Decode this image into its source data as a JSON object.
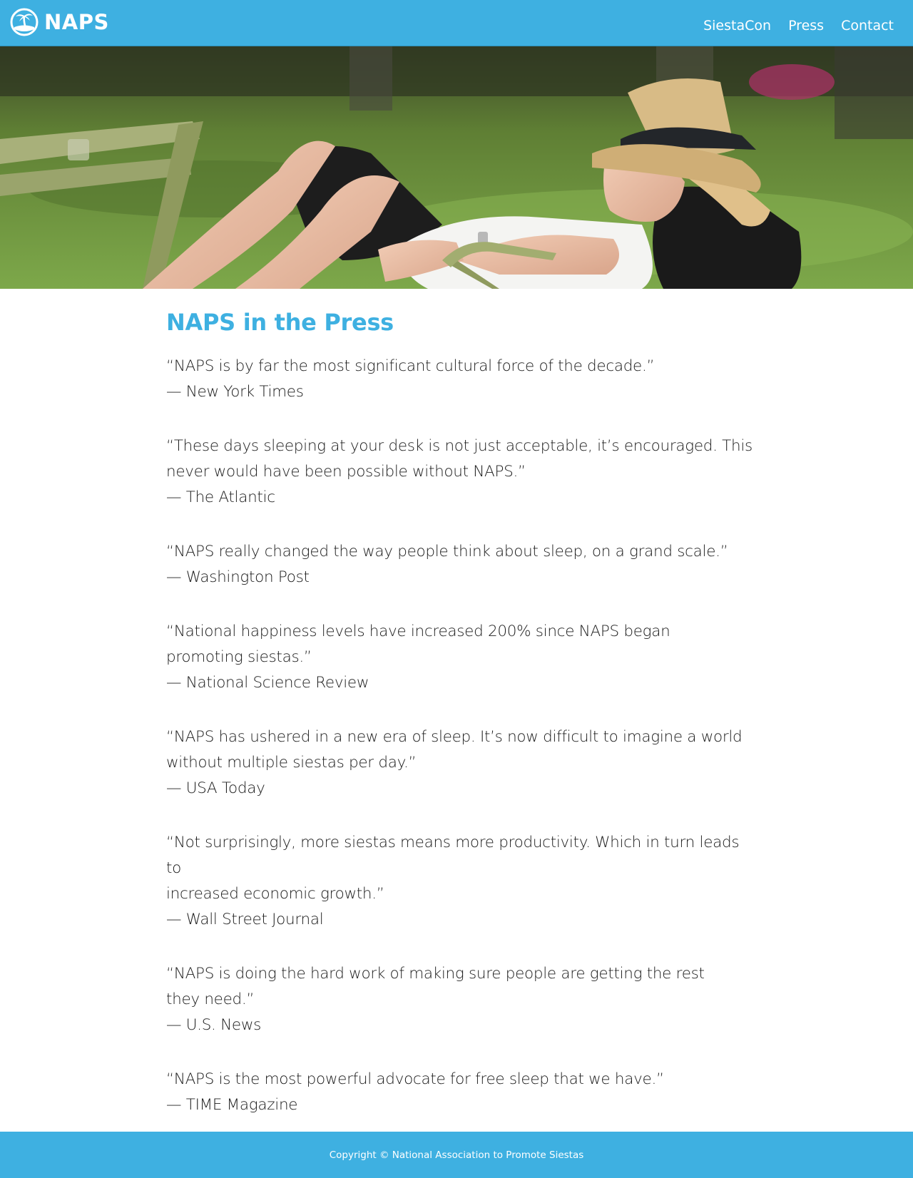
{
  "header": {
    "logo_text": "NAPS",
    "nav": [
      {
        "label": "SiestaCon"
      },
      {
        "label": "Press"
      },
      {
        "label": "Contact"
      }
    ]
  },
  "main": {
    "title": "NAPS in the Press",
    "quotes": [
      {
        "lines": [
          "“NAPS is by far the most significant cultural force of the decade.”"
        ],
        "source": "— New York Times"
      },
      {
        "lines": [
          "“These days sleeping at your desk is not just acceptable, it’s encouraged. This",
          "never would have been possible without NAPS.”"
        ],
        "source": "— The Atlantic"
      },
      {
        "lines": [
          "“NAPS really changed the way people think about sleep, on a grand scale.”"
        ],
        "source": "— Washington Post"
      },
      {
        "lines": [
          "“National happiness levels have increased 200% since NAPS began",
          "promoting siestas.”"
        ],
        "source": "— National Science Review"
      },
      {
        "lines": [
          "“NAPS has ushered in a new era of sleep. It’s now difficult to imagine a world",
          "without multiple siestas per day.”"
        ],
        "source": "— USA Today"
      },
      {
        "lines": [
          "“Not surprisingly, more siestas means more productivity. Which in turn leads to",
          "increased economic growth.”"
        ],
        "source": "— Wall Street Journal"
      },
      {
        "lines": [
          "“NAPS is doing the hard work of making sure people are getting the rest",
          "they need.”"
        ],
        "source": "— U.S. News"
      },
      {
        "lines": [
          "“NAPS is the most powerful advocate for free sleep that we have.”"
        ],
        "source": "— TIME Magazine"
      }
    ]
  },
  "footer": {
    "copyright": "Copyright © National Association to Promote Siestas"
  },
  "colors": {
    "brand": "#3eb0e1"
  },
  "icons": {
    "logo": "palm-tree-sun-icon"
  }
}
